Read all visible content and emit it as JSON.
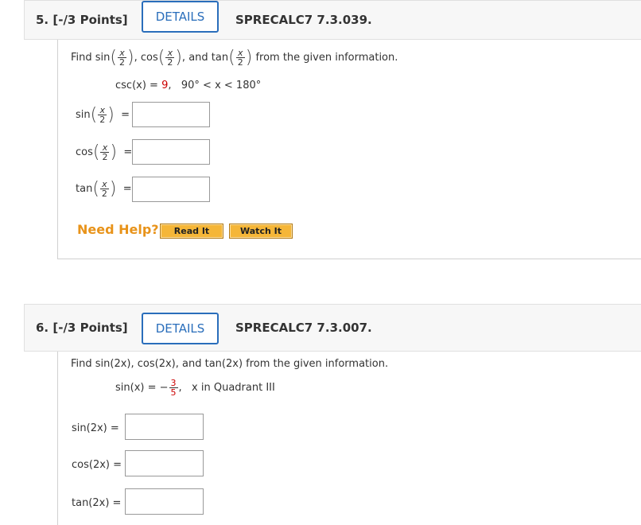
{
  "q5": {
    "number": "5. [-/3 Points]",
    "details_label": "DETAILS",
    "qid": "SPRECALC7 7.3.039.",
    "find_prefix": "Find",
    "sin": "sin",
    "cos": "cos",
    "tan": "tan",
    "and_text": "and",
    "find_suffix": "from the given information.",
    "x": "x",
    "two": "2",
    "given_csc": "csc(x) = ",
    "given_value": "9",
    "given_range": "90° < x < 180°",
    "eq": "=",
    "help_label": "Need Help?",
    "read_it": "Read It",
    "watch_it": "Watch It"
  },
  "q6": {
    "number": "6. [-/3 Points]",
    "details_label": "DETAILS",
    "qid": "SPRECALC7 7.3.007.",
    "prompt": "Find sin(2x), cos(2x), and tan(2x) from the given information.",
    "given_sin": "sin(x) = −",
    "given_num": "3",
    "given_den": "5",
    "given_quadrant": "x in Quadrant III",
    "label_sin2x": "sin(2x) =",
    "label_cos2x": "cos(2x) =",
    "label_tan2x": "tan(2x) ="
  },
  "colors": {
    "accent": "#2a6ebb",
    "help_orange": "#e8931a",
    "button_orange": "#f5b638",
    "given_red": "#cc0000"
  }
}
